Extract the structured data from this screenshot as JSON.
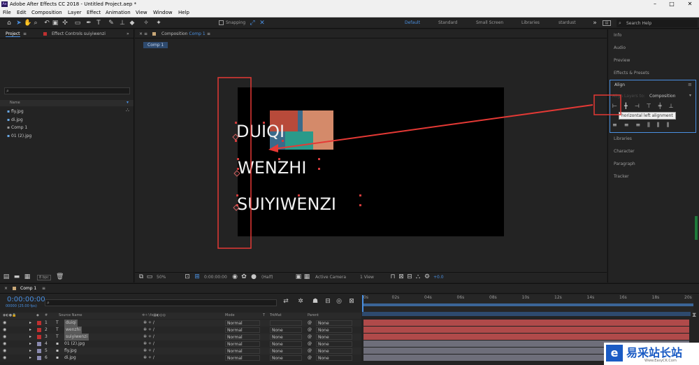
{
  "app": {
    "title": "Adobe After Effects CC 2018 - Untitled Project.aep *",
    "logo": "Ae"
  },
  "menu": [
    "File",
    "Edit",
    "Composition",
    "Layer",
    "Effect",
    "Animation",
    "View",
    "Window",
    "Help"
  ],
  "toolbar": {
    "snapping": "Snapping",
    "workspaces": [
      "Default",
      "Standard",
      "Small Screen",
      "Libraries",
      "stardust"
    ],
    "search_placeholder": "Search Help"
  },
  "project": {
    "tab": "Project",
    "effect_tab": "Effect Controls suiyiwenzi",
    "column": "Name",
    "items": [
      "fly.jpg",
      "di.jpg",
      "Comp 1",
      "01 (2).jpg"
    ],
    "bpc": "8 bpc"
  },
  "viewer": {
    "tab": "Composition",
    "comp_name": "Comp 1",
    "crumb": "Comp 1",
    "texts": [
      "DUIQI",
      "WENZHI",
      "SUIYIWENZI"
    ],
    "zoom": "50%",
    "timecode": "0:00:00:00",
    "resolution": "(Half)",
    "camera": "Active Camera",
    "views": "1 View",
    "exposure": "+0.0"
  },
  "right": {
    "sections_top": [
      "Info",
      "Audio",
      "Preview",
      "Effects & Presets"
    ],
    "align_title": "Align",
    "align_to_label": "Align Layers to:",
    "align_to_value": "Composition",
    "tooltip": "horizontal left alignment",
    "sections_bottom": [
      "Libraries",
      "Character",
      "Paragraph",
      "Tracker"
    ]
  },
  "timeline": {
    "tab": "Comp 1",
    "timecode": "0:00:00:00",
    "fps": "00000 (25.00 fps)",
    "columns": {
      "source": "Source Name",
      "mode": "Mode",
      "t": "T",
      "trkmat": "TrkMat",
      "parent": "Parent"
    },
    "layers": [
      {
        "num": "1",
        "name": "duiqi",
        "mode": "Normal",
        "trkmat": "",
        "parent": "None",
        "type": "T"
      },
      {
        "num": "2",
        "name": "wenzhi",
        "mode": "Normal",
        "trkmat": "None",
        "parent": "None",
        "type": "T"
      },
      {
        "num": "3",
        "name": "suiyiwenzi",
        "mode": "Normal",
        "trkmat": "None",
        "parent": "None",
        "type": "T"
      },
      {
        "num": "4",
        "name": "01 (2).jpg",
        "mode": "Normal",
        "trkmat": "None",
        "parent": "None",
        "type": "img"
      },
      {
        "num": "5",
        "name": "fly.jpg",
        "mode": "Normal",
        "trkmat": "None",
        "parent": "None",
        "type": "img"
      },
      {
        "num": "6",
        "name": "di.jpg",
        "mode": "Normal",
        "trkmat": "None",
        "parent": "None",
        "type": "img"
      }
    ],
    "ruler": [
      "0s",
      "02s",
      "04s",
      "06s",
      "08s",
      "10s",
      "12s",
      "14s",
      "16s",
      "18s",
      "20s"
    ]
  },
  "watermark": {
    "text": "易采站长站",
    "sub": "Www.EasyCK.Com"
  },
  "colors": {
    "accent": "#4a90e2",
    "annotation": "#e53935",
    "text_bar": "#b04a4a",
    "img_bar": "#6e6e7a"
  }
}
